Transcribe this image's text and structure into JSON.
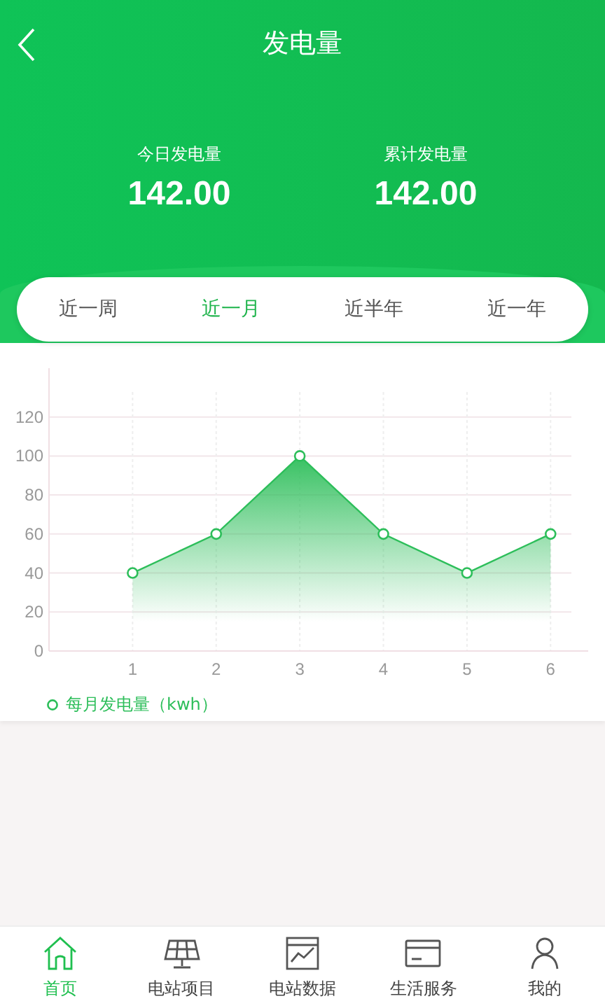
{
  "header": {
    "title": "发电量"
  },
  "stats": [
    {
      "label": "今日发电量",
      "value": "142.00"
    },
    {
      "label": "累计发电量",
      "value": "142.00"
    }
  ],
  "periods": [
    {
      "label": "近一周",
      "selected": false
    },
    {
      "label": "近一月",
      "selected": true
    },
    {
      "label": "近半年",
      "selected": false
    },
    {
      "label": "近一年",
      "selected": false
    }
  ],
  "chart_data": {
    "type": "area",
    "x": [
      1,
      2,
      3,
      4,
      5,
      6
    ],
    "series": [
      {
        "name": "每月发电量（kwh）",
        "color": "#2dbe5a",
        "values": [
          40,
          60,
          100,
          60,
          40,
          60
        ]
      }
    ],
    "ylim": [
      0,
      145
    ],
    "xlim": [
      0,
      6.45
    ],
    "grid": true,
    "yticks": [
      0,
      20,
      40,
      60,
      80,
      100,
      120
    ],
    "xticks": [
      1,
      2,
      3,
      4,
      5,
      6
    ]
  },
  "tabbar": [
    {
      "label": "首页",
      "kind": "home",
      "selected": true
    },
    {
      "label": "电站项目",
      "kind": "solar",
      "selected": false
    },
    {
      "label": "电站数据",
      "kind": "data",
      "selected": false
    },
    {
      "label": "生活服务",
      "kind": "card",
      "selected": false
    },
    {
      "label": "我的",
      "kind": "user",
      "selected": false
    }
  ]
}
